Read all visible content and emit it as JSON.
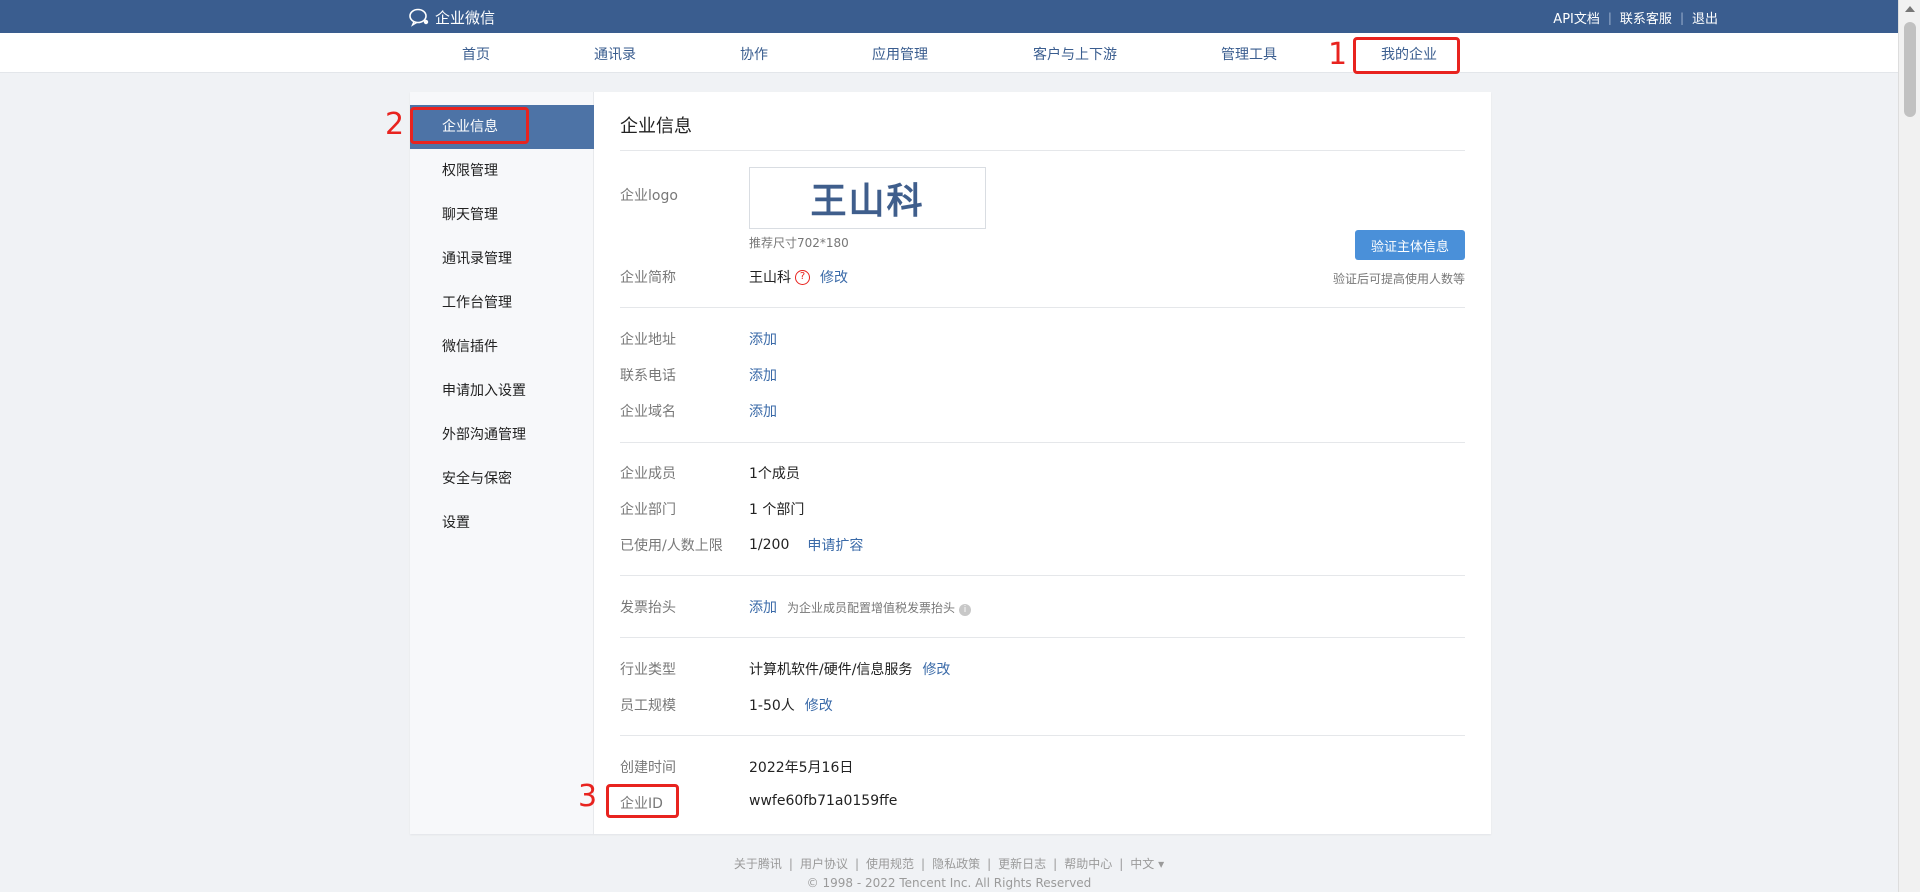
{
  "topbar": {
    "brand": "企业微信",
    "links": [
      "API文档",
      "联系客服",
      "退出"
    ]
  },
  "nav": {
    "items": [
      "首页",
      "通讯录",
      "协作",
      "应用管理",
      "客户与上下游",
      "管理工具",
      "我的企业"
    ]
  },
  "annotations": [
    "1",
    "2",
    "3"
  ],
  "sidebar": {
    "items": [
      "企业信息",
      "权限管理",
      "聊天管理",
      "通讯录管理",
      "工作台管理",
      "微信插件",
      "申请加入设置",
      "外部沟通管理",
      "安全与保密",
      "设置"
    ]
  },
  "content": {
    "title": "企业信息",
    "logo": {
      "label": "企业logo",
      "text": "王山科",
      "hint": "推荐尺寸702*180"
    },
    "short_name": {
      "label": "企业简称",
      "value": "王山科",
      "action": "修改"
    },
    "verify": {
      "button": "验证主体信息",
      "hint": "验证后可提高使用人数等"
    },
    "address": {
      "label": "企业地址",
      "action": "添加"
    },
    "phone": {
      "label": "联系电话",
      "action": "添加"
    },
    "domain": {
      "label": "企业域名",
      "action": "添加"
    },
    "members": {
      "label": "企业成员",
      "value": "1个成员"
    },
    "departments": {
      "label": "企业部门",
      "value": "1 个部门"
    },
    "usage": {
      "label": "已使用/人数上限",
      "value": "1/200",
      "action": "申请扩容"
    },
    "invoice": {
      "label": "发票抬头",
      "action": "添加",
      "hint": "为企业成员配置增值税发票抬头"
    },
    "industry": {
      "label": "行业类型",
      "value": "计算机软件/硬件/信息服务",
      "action": "修改"
    },
    "scale": {
      "label": "员工规模",
      "value": "1-50人",
      "action": "修改"
    },
    "created": {
      "label": "创建时间",
      "value": "2022年5月16日"
    },
    "corp_id": {
      "label": "企业ID",
      "value": "wwfe60fb71a0159ffe"
    }
  },
  "footer": {
    "links": [
      "关于腾讯",
      "用户协议",
      "使用规范",
      "隐私政策",
      "更新日志",
      "帮助中心",
      "中文 ▾"
    ],
    "copyright": "© 1998 - 2022 Tencent Inc. All Rights Reserved"
  },
  "colors": {
    "topbar": "#3a5d8f",
    "accent": "#4d73a6",
    "link": "#3a6aa8",
    "button": "#4a90d9",
    "annotation": "#e8231f"
  }
}
